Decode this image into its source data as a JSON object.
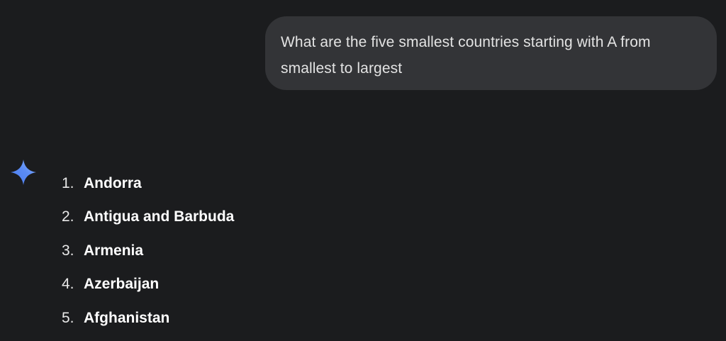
{
  "user_prompt": {
    "text": "What are the five smallest countries starting with A from smallest to largest"
  },
  "assistant": {
    "icon": "gemini-sparkle-icon",
    "icon_colors": [
      "#4285f4",
      "#9b72cb",
      "#d96570"
    ],
    "answer_items": [
      {
        "number": "1.",
        "name": "Andorra"
      },
      {
        "number": "2.",
        "name": "Antigua and Barbuda"
      },
      {
        "number": "3.",
        "name": "Armenia"
      },
      {
        "number": "4.",
        "name": "Azerbaijan"
      },
      {
        "number": "5.",
        "name": "Afghanistan"
      }
    ]
  },
  "colors": {
    "background": "#1b1c1e",
    "user_bubble": "#333437",
    "text": "#e3e3e3"
  }
}
